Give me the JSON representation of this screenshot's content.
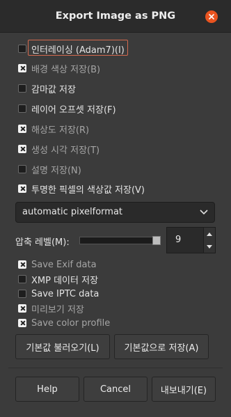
{
  "window": {
    "title": "Export Image as PNG"
  },
  "options": [
    {
      "label": "인터레이싱 (Adam7)(I)",
      "checked": false,
      "dim": false
    },
    {
      "label": "배경 색상 저장(B)",
      "checked": true,
      "dim": true
    },
    {
      "label": "감마값 저장",
      "checked": false,
      "dim": false
    },
    {
      "label": "레이어 오프셋 저장(F)",
      "checked": false,
      "dim": false
    },
    {
      "label": "해상도 저장(R)",
      "checked": true,
      "dim": true
    },
    {
      "label": "생성 시각 저장(T)",
      "checked": true,
      "dim": true
    },
    {
      "label": "설명 저장(N)",
      "checked": false,
      "dim": true
    },
    {
      "label": "투명한 픽셀의 색상값 저장(V)",
      "checked": true,
      "dim": false
    }
  ],
  "pixelformat": {
    "selected": "automatic pixelformat"
  },
  "compression": {
    "label": "압축 레벨(M):",
    "value": "9",
    "level": 9,
    "max": 9
  },
  "metadata": [
    {
      "label": "Save Exif data",
      "checked": true,
      "dim": true
    },
    {
      "label": "XMP 데이터 저장",
      "checked": false,
      "dim": false
    },
    {
      "label": "Save IPTC data",
      "checked": false,
      "dim": false
    },
    {
      "label": "미리보기 저장",
      "checked": true,
      "dim": true
    },
    {
      "label": "Save color profile",
      "checked": true,
      "dim": true
    }
  ],
  "defaults": {
    "load_label": "기본값 불러오기(L)",
    "save_label": "기본값으로 저장(A)"
  },
  "actions": {
    "help_label": "Help",
    "cancel_label": "Cancel",
    "export_label": "내보내기(E)"
  },
  "colors": {
    "accent": "#e95420",
    "focus": "#d46a4f"
  }
}
